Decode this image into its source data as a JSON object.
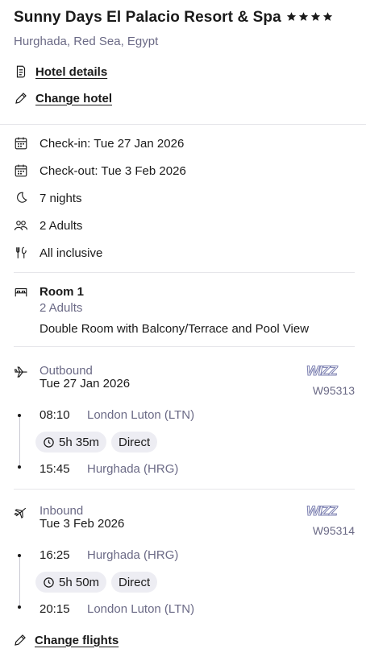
{
  "hotel": {
    "name": "Sunny Days El Palacio Resort & Spa",
    "stars": 4,
    "location": "Hurghada, Red Sea, Egypt",
    "details_link": "Hotel details",
    "change_link": "Change hotel"
  },
  "stay": {
    "checkin": "Check-in: Tue 27 Jan 2026",
    "checkout": "Check-out: Tue 3 Feb 2026",
    "nights": "7 nights",
    "guests": "2 Adults",
    "board": "All inclusive"
  },
  "room": {
    "title": "Room 1",
    "guests": "2 Adults",
    "description": "Double Room with Balcony/Terrace and Pool View"
  },
  "outbound": {
    "label": "Outbound",
    "date": "Tue 27 Jan 2026",
    "airline": "WIZZ",
    "flight_number": "W95313",
    "depart_time": "08:10",
    "depart_airport": "London Luton (LTN)",
    "duration": "5h 35m",
    "stops": "Direct",
    "arrive_time": "15:45",
    "arrive_airport": "Hurghada (HRG)"
  },
  "inbound": {
    "label": "Inbound",
    "date": "Tue 3 Feb 2026",
    "airline": "WIZZ",
    "flight_number": "W95314",
    "depart_time": "16:25",
    "depart_airport": "Hurghada (HRG)",
    "duration": "5h 50m",
    "stops": "Direct",
    "arrive_time": "20:15",
    "arrive_airport": "London Luton (LTN)"
  },
  "flights": {
    "change_link": "Change flights"
  }
}
